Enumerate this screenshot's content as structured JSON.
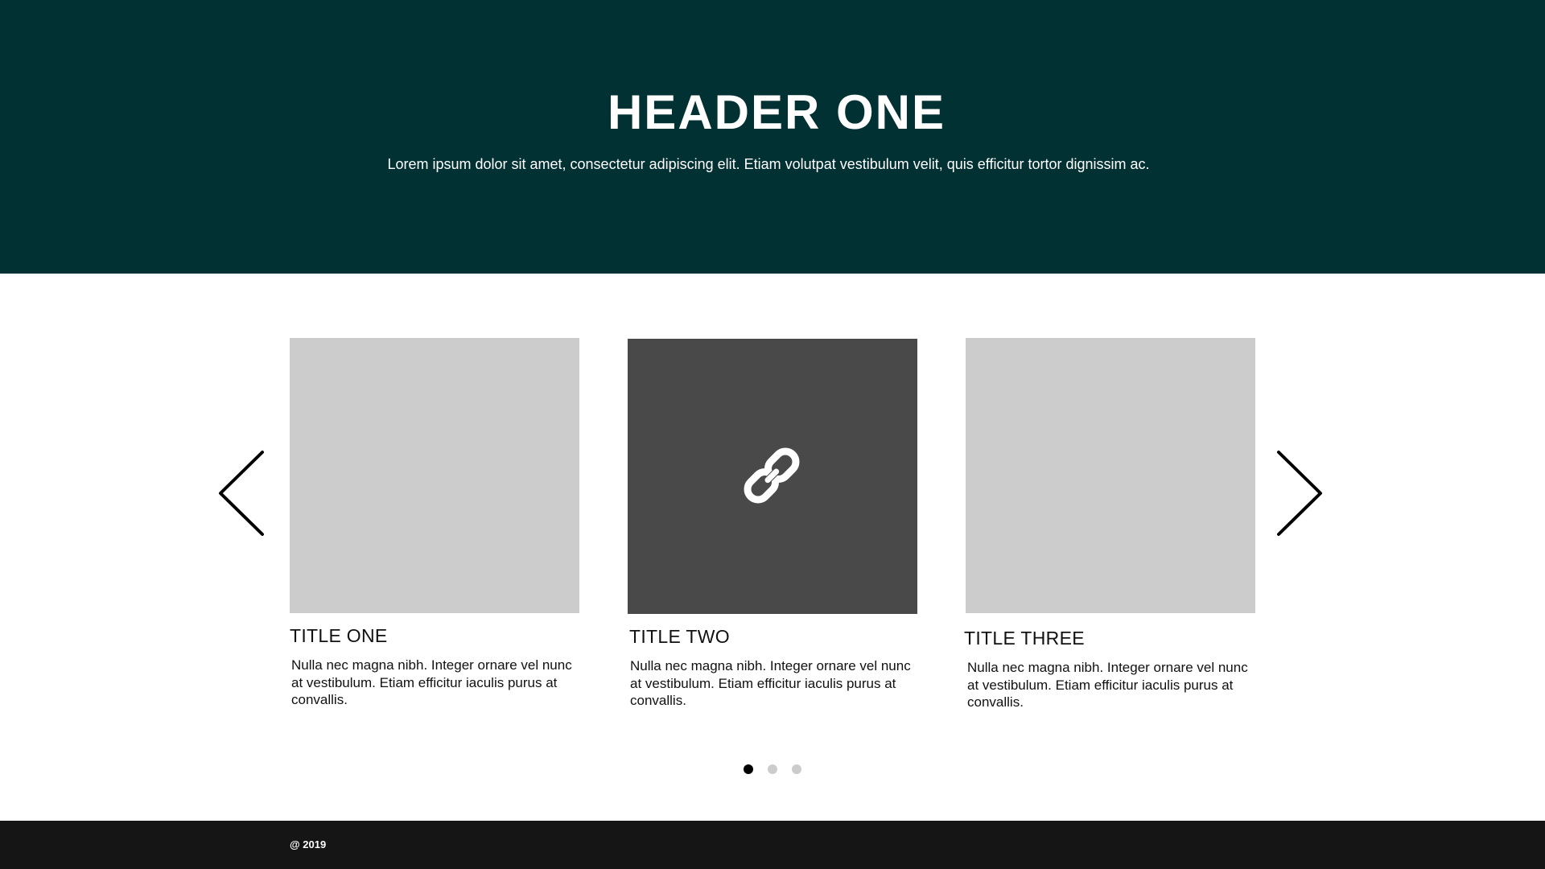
{
  "hero": {
    "title": "HEADER ONE",
    "subtitle": "Lorem ipsum dolor sit amet, consectetur adipiscing elit. Etiam volutpat vestibulum velit, quis efficitur tortor dignissim ac.",
    "background_color": "#023134"
  },
  "carousel": {
    "prev_icon": "chevron-left-icon",
    "next_icon": "chevron-right-icon",
    "cards": [
      {
        "title": "TITLE ONE",
        "text": "Nulla nec magna nibh. Integer ornare vel nunc at vestibulum. Etiam efficitur iaculis purus at convallis.",
        "image_color": "#cccccc"
      },
      {
        "title": "TITLE TWO",
        "text": "Nulla nec magna nibh. Integer ornare vel nunc at vestibulum. Etiam efficitur iaculis purus at convallis.",
        "image_color": "#494949",
        "overlay_icon": "link-icon"
      },
      {
        "title": "TITLE THREE",
        "text": "Nulla nec magna nibh. Integer ornare vel nunc at vestibulum. Etiam efficitur iaculis purus at convallis.",
        "image_color": "#cccccc"
      }
    ],
    "pagination": {
      "count": 3,
      "active_index": 0,
      "active_color": "#000000",
      "inactive_color": "#cccccc"
    }
  },
  "footer": {
    "copyright": "@ 2019",
    "background_color": "#151515"
  }
}
